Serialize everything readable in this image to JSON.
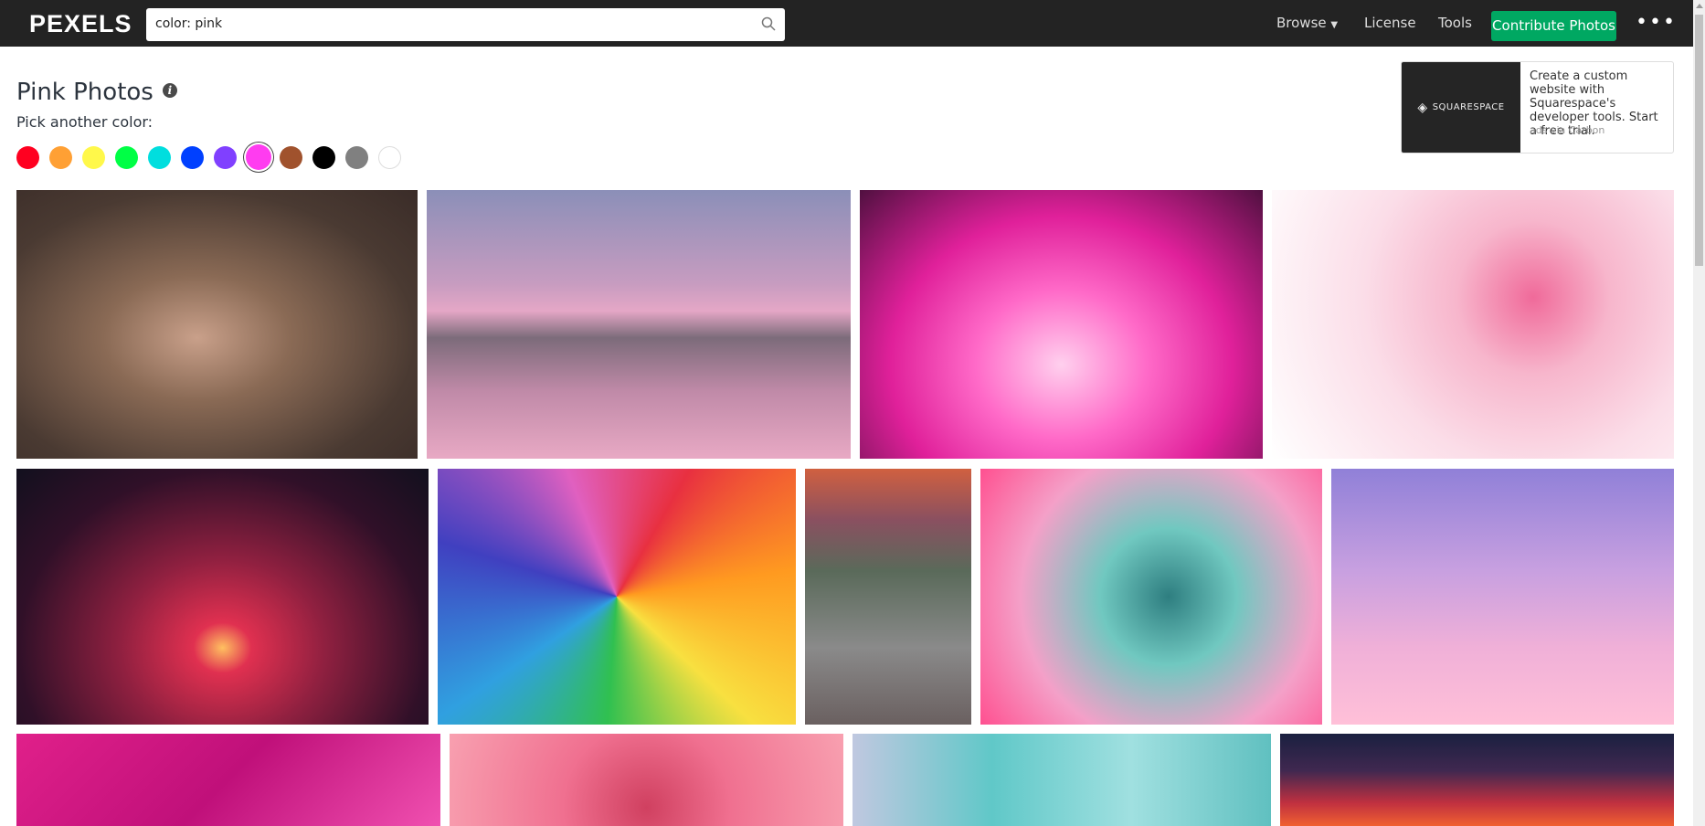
{
  "header": {
    "logo": "PEXELS",
    "search_value": "color: pink",
    "nav": {
      "browse": "Browse",
      "license": "License",
      "tools": "Tools",
      "contribute": "Contribute Photos",
      "more": "•••"
    }
  },
  "page": {
    "title": "Pink Photos",
    "pick_label": "Pick another color:"
  },
  "colors": [
    {
      "name": "red",
      "hex": "#ff0020"
    },
    {
      "name": "orange",
      "hex": "#ffa034"
    },
    {
      "name": "yellow",
      "hex": "#fff84a"
    },
    {
      "name": "green",
      "hex": "#00ff45"
    },
    {
      "name": "turquoise",
      "hex": "#00dede"
    },
    {
      "name": "blue",
      "hex": "#0040ff"
    },
    {
      "name": "violet",
      "hex": "#8040ff"
    },
    {
      "name": "pink",
      "hex": "#ff3cf0",
      "selected": true
    },
    {
      "name": "brown",
      "hex": "#a0522d"
    },
    {
      "name": "black",
      "hex": "#000000"
    },
    {
      "name": "gray",
      "hex": "#808080"
    },
    {
      "name": "white",
      "hex": "#ffffff"
    }
  ],
  "ad": {
    "brand": "SQUARESPACE",
    "text": "Create a custom website with Squarespace's developer tools. Start a free trial.",
    "via": "ads via Carbon"
  },
  "accent": "#00a862"
}
